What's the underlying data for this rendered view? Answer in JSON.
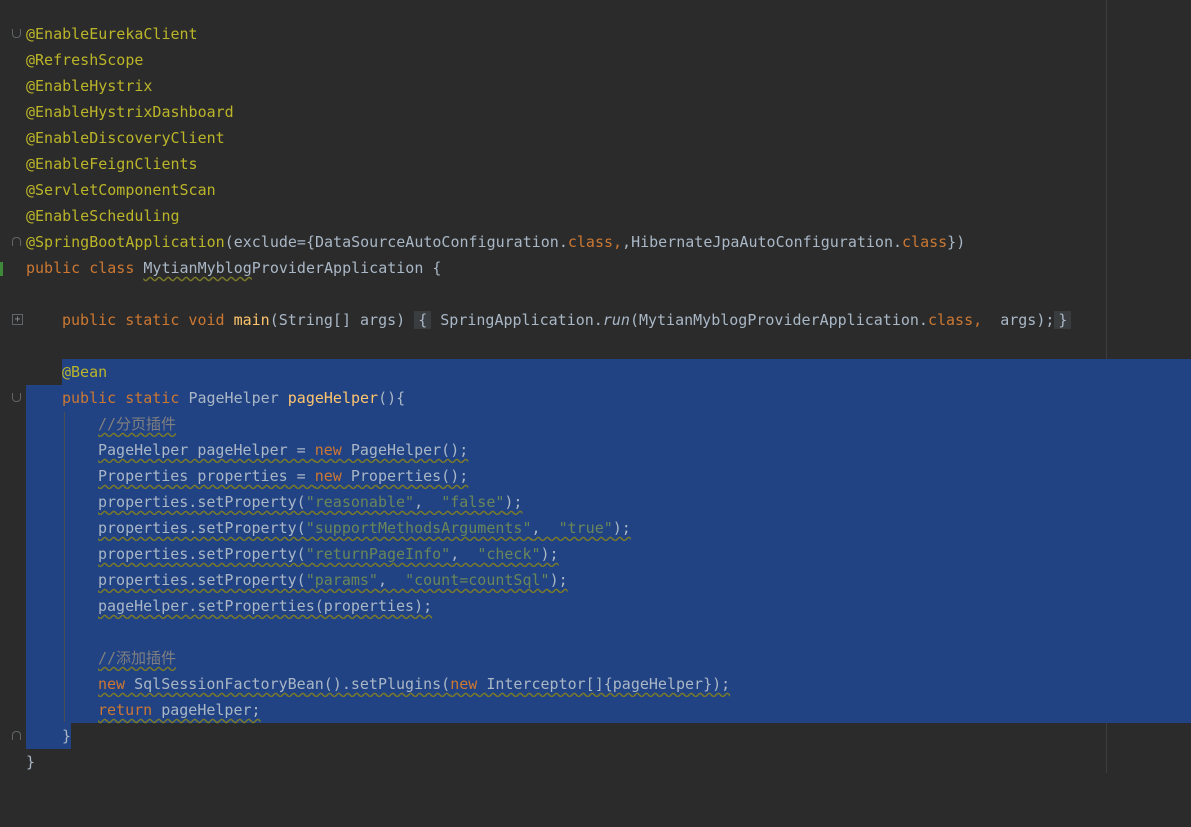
{
  "annotations": [
    "@EnableEurekaClient",
    "@RefreshScope",
    "@EnableHystrix",
    "@EnableHystrixDashboard",
    "@EnableDiscoveryClient",
    "@EnableFeignClients",
    "@ServletComponentScan",
    "@EnableScheduling"
  ],
  "code": {
    "spring_boot_ann": "@SpringBootApplication",
    "spring_boot_args": "(exclude={DataSourceAutoConfiguration.",
    "class_kw1": "class",
    "spring_boot_args2": ",HibernateJpaAutoConfiguration.",
    "class_kw2": "class",
    "spring_boot_close": "})",
    "class_decl_kw": "public class ",
    "class_name_u": "MytianMyblog",
    "class_name_rest": "ProviderApplication {",
    "main_kw": "public static void ",
    "main_fn": "main",
    "main_params": "(String[] args)",
    "main_open": "{",
    "main_body": " SpringApplication.",
    "main_run": "run",
    "main_body2": "(MytianMyblogProviderApplication.",
    "main_class_kw": "class,",
    "main_body3": "  args);",
    "main_close": "}",
    "bean_ann": "@Bean",
    "ph_kw": "public static ",
    "ph_type": "PageHelper ",
    "ph_fn": "pageHelper",
    "ph_open": "(){",
    "c1": "//分页插件",
    "l1a": "PageHelper pageHelper = ",
    "l1kw": "new",
    "l1b": " PageHelper();",
    "l2a": "Properties properties = ",
    "l2kw": "new",
    "l2b": " Properties();",
    "l3a": "properties.setProperty(",
    "l3s1": "\"reasonable\"",
    "l3c": ",  ",
    "l3s2": "\"false\"",
    "l3d": ");",
    "l4a": "properties.setProperty(",
    "l4s1": "\"supportMethodsArguments\"",
    "l4c": ",  ",
    "l4s2": "\"true\"",
    "l4d": ");",
    "l5a": "properties.setProperty(",
    "l5s1": "\"returnPageInfo\"",
    "l5c": ",  ",
    "l5s2": "\"check\"",
    "l5d": ");",
    "l6a": "properties.setProperty(",
    "l6s1": "\"params\"",
    "l6c": ",  ",
    "l6s2": "\"count=countSql\"",
    "l6d": ");",
    "l7": "pageHelper.setProperties(properties);",
    "c2": "//添加插件",
    "l8kw": "new",
    "l8a": " SqlSessionFactoryBean().setPlugins(",
    "l8kw2": "new",
    "l8b": " Interceptor[]{pageHelper});",
    "l9kw": "return",
    "l9a": " pageHelper;",
    "close_inner": "}",
    "close_outer": "}"
  },
  "colors": {
    "background": "#2b2b2b",
    "selection": "#214283",
    "annotation": "#bbb529",
    "keyword": "#cc7832",
    "function": "#ffc66d",
    "string": "#6a8759",
    "comment": "#808080",
    "text": "#a9b7c6"
  }
}
